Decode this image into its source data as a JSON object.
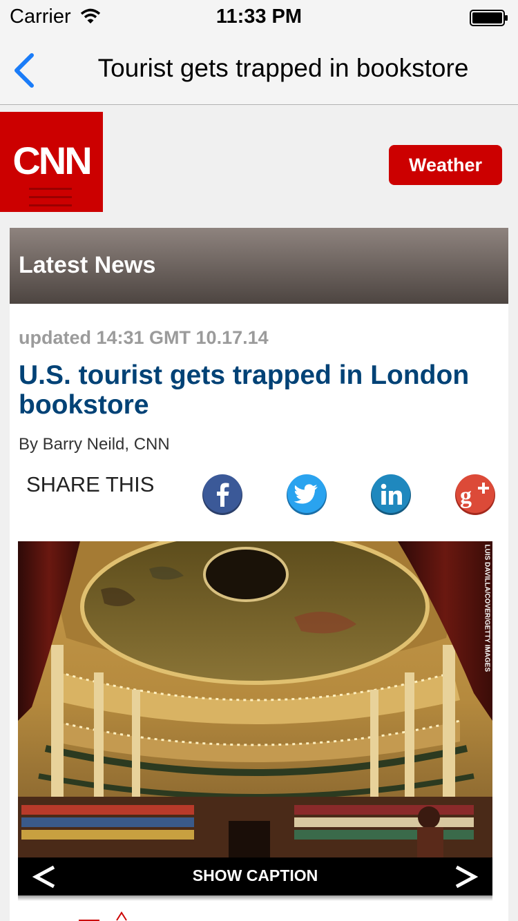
{
  "status_bar": {
    "carrier": "Carrier",
    "time": "11:33 PM",
    "icons": [
      "wifi-icon",
      "battery-icon"
    ]
  },
  "nav_bar": {
    "back_icon": "chevron-left-icon",
    "title": "Tourist gets trapped in bookstore",
    "accent_color": "#1a7cf8"
  },
  "header": {
    "logo_text": "CNN",
    "brand_color": "#cc0000",
    "weather_label": "Weather"
  },
  "section": {
    "title": "Latest News"
  },
  "article": {
    "updated": "updated 14:31 GMT 10.17.14",
    "headline": "U.S. tourist gets trapped in London bookstore",
    "byline": "By Barry Neild, CNN",
    "headline_color": "#004276"
  },
  "share": {
    "label": "SHARE THIS",
    "buttons": [
      {
        "name": "facebook",
        "icon": "facebook-icon",
        "color": "#3b5998"
      },
      {
        "name": "twitter",
        "icon": "twitter-icon",
        "color": "#2aa3ef"
      },
      {
        "name": "linkedin",
        "icon": "linkedin-icon",
        "color": "#1f88be"
      },
      {
        "name": "google-plus",
        "icon": "google-plus-icon",
        "color": "#dc4a38"
      }
    ]
  },
  "gallery": {
    "photo_credit": "LUIS DAVILLA/COVER/GETTY IMAGES",
    "caption_label": "SHOW CAPTION",
    "prev_icon": "chevron-left-icon",
    "next_icon": "chevron-right-icon"
  }
}
